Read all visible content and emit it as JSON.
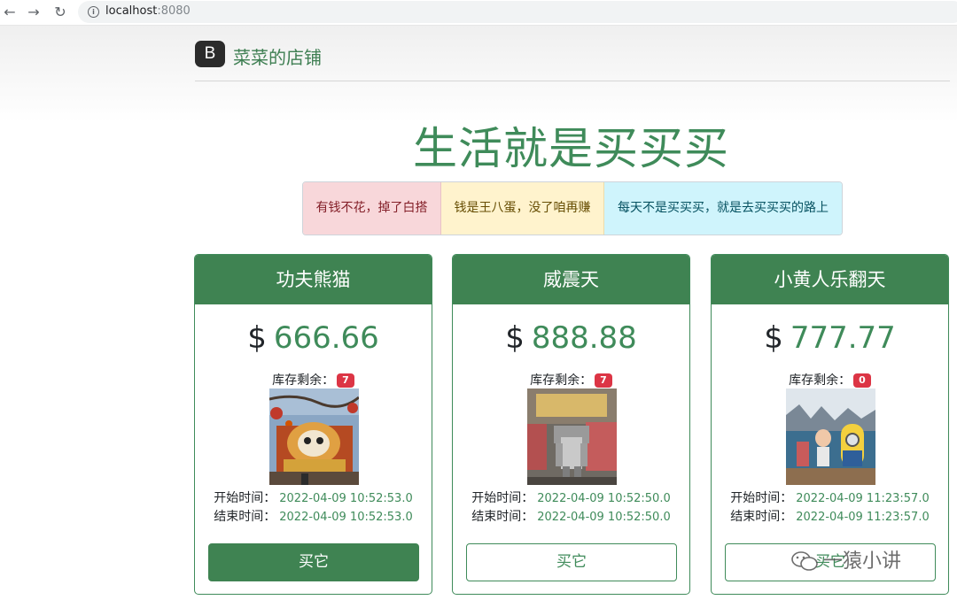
{
  "browser": {
    "url_host": "localhost",
    "url_port": ":8080"
  },
  "header": {
    "logo_letter": "B",
    "brand_name": "菜菜的店铺"
  },
  "hero": {
    "title": "生活就是买买买"
  },
  "alerts": [
    {
      "text": "有钱不花，掉了白搭",
      "color": "#f8d7da"
    },
    {
      "text": "钱是王八蛋，没了咱再赚",
      "color": "#fff3cd"
    },
    {
      "text": "每天不是买买买，就是去买买买的路上",
      "color": "#cff4fc"
    }
  ],
  "products": [
    {
      "name": "功夫熊猫",
      "currency": "$",
      "price": "666.66",
      "stock_label": "库存剩余：",
      "stock": "7",
      "start_label": "开始时间：",
      "start_time": "2022-04-09 10:52:53.0",
      "end_label": "结束时间：",
      "end_time": "2022-04-09 10:52:53.0",
      "buy_label": "买它",
      "buy_style": "solid"
    },
    {
      "name": "威震天",
      "currency": "$",
      "price": "888.88",
      "stock_label": "库存剩余：",
      "stock": "7",
      "start_label": "开始时间：",
      "start_time": "2022-04-09 10:52:50.0",
      "end_label": "结束时间：",
      "end_time": "2022-04-09 10:52:50.0",
      "buy_label": "买它",
      "buy_style": "outline"
    },
    {
      "name": "小黄人乐翻天",
      "currency": "$",
      "price": "777.77",
      "stock_label": "库存剩余：",
      "stock": "0",
      "start_label": "开始时间：",
      "start_time": "2022-04-09 11:23:57.0",
      "end_label": "结束时间：",
      "end_time": "2022-04-09 11:23:57.0",
      "buy_label": "买它",
      "buy_style": "outline"
    }
  ],
  "watermark": {
    "text": "一猿小讲"
  },
  "colors": {
    "primary_green": "#3f8352",
    "badge_red": "#dc3545"
  }
}
